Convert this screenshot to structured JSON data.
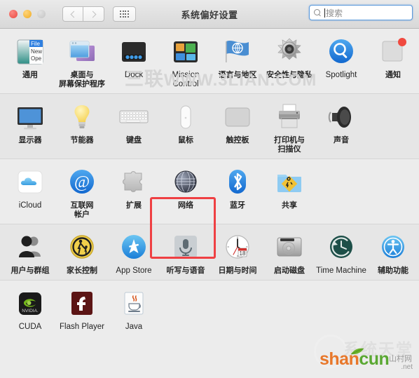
{
  "window": {
    "title": "系统偏好设置",
    "traffic_lights": [
      {
        "name": "close",
        "color": "#ef5951"
      },
      {
        "name": "minimize",
        "color": "#f3b63b"
      },
      {
        "name": "zoom",
        "color": "#cbcbcb"
      }
    ],
    "nav": {
      "back": "‹",
      "forward": "›",
      "show_all": "show-all-grid"
    },
    "search": {
      "placeholder": "搜索",
      "value": "",
      "focused": true
    }
  },
  "highlight": {
    "target": "网络",
    "color": "#ef4043"
  },
  "watermarks": {
    "top": {
      "cn": "三联",
      "en": "WWW.3LIAN.COM"
    },
    "bottom": {
      "cn": "系统天堂",
      "brand_a": "shan",
      "brand_b": "cun",
      "sub": "山村网",
      "tld": ".net"
    }
  },
  "rows": [
    {
      "id": "personal",
      "items": [
        {
          "label": "通用",
          "icon": "general-icon",
          "latin": false
        },
        {
          "label": "桌面与\n屏幕保护程序",
          "icon": "desktop-screensaver-icon",
          "latin": false
        },
        {
          "label": "Dock",
          "icon": "dock-icon",
          "latin": true
        },
        {
          "label": "Mission\nControl",
          "icon": "mission-control-icon",
          "latin": true
        },
        {
          "label": "语言与地区",
          "icon": "language-region-icon",
          "latin": false
        },
        {
          "label": "安全性与隐私",
          "icon": "security-privacy-icon",
          "latin": false
        },
        {
          "label": "Spotlight",
          "icon": "spotlight-icon",
          "latin": true
        },
        {
          "label": "通知",
          "icon": "notifications-icon",
          "latin": false
        }
      ]
    },
    {
      "id": "hardware",
      "items": [
        {
          "label": "显示器",
          "icon": "displays-icon",
          "latin": false
        },
        {
          "label": "节能器",
          "icon": "energy-saver-icon",
          "latin": false
        },
        {
          "label": "键盘",
          "icon": "keyboard-icon",
          "latin": false
        },
        {
          "label": "鼠标",
          "icon": "mouse-icon",
          "latin": false
        },
        {
          "label": "触控板",
          "icon": "trackpad-icon",
          "latin": false
        },
        {
          "label": "打印机与\n扫描仪",
          "icon": "printers-scanners-icon",
          "latin": false
        },
        {
          "label": "声音",
          "icon": "sound-icon",
          "latin": false
        }
      ]
    },
    {
      "id": "internet",
      "items": [
        {
          "label": "iCloud",
          "icon": "icloud-icon",
          "latin": true
        },
        {
          "label": "互联网\n帐户",
          "icon": "internet-accounts-icon",
          "latin": false
        },
        {
          "label": "扩展",
          "icon": "extensions-icon",
          "latin": false
        },
        {
          "label": "网络",
          "icon": "network-icon",
          "latin": false
        },
        {
          "label": "蓝牙",
          "icon": "bluetooth-icon",
          "latin": false
        },
        {
          "label": "共享",
          "icon": "sharing-icon",
          "latin": false
        }
      ]
    },
    {
      "id": "system",
      "items": [
        {
          "label": "用户与群组",
          "icon": "users-groups-icon",
          "latin": false
        },
        {
          "label": "家长控制",
          "icon": "parental-controls-icon",
          "latin": false
        },
        {
          "label": "App Store",
          "icon": "app-store-icon",
          "latin": true
        },
        {
          "label": "听写与语音",
          "icon": "dictation-speech-icon",
          "latin": false
        },
        {
          "label": "日期与时间",
          "icon": "date-time-icon",
          "latin": false
        },
        {
          "label": "启动磁盘",
          "icon": "startup-disk-icon",
          "latin": false
        },
        {
          "label": "Time Machine",
          "icon": "time-machine-icon",
          "latin": true
        },
        {
          "label": "辅助功能",
          "icon": "accessibility-icon",
          "latin": false
        }
      ]
    },
    {
      "id": "other",
      "items": [
        {
          "label": "CUDA",
          "icon": "cuda-icon",
          "latin": true
        },
        {
          "label": "Flash Player",
          "icon": "flash-player-icon",
          "latin": true
        },
        {
          "label": "Java",
          "icon": "java-icon",
          "latin": true
        }
      ]
    }
  ]
}
